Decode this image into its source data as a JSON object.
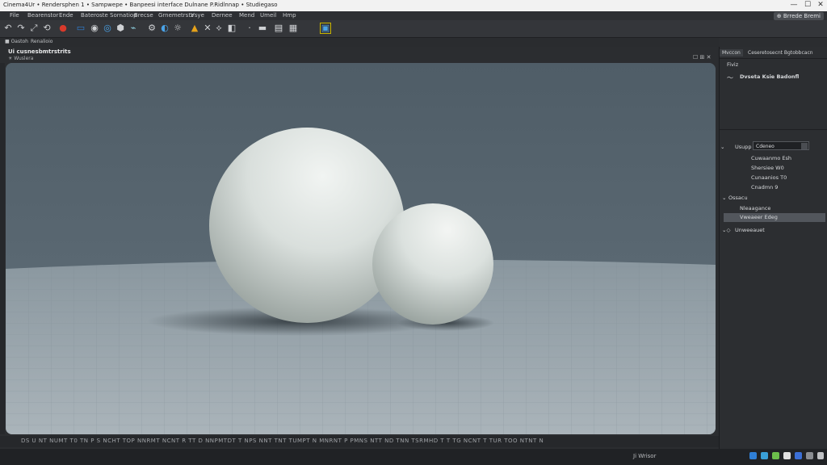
{
  "window": {
    "title": "Cinema4Ur • Rendersphen 1 • Sampwepe • Banpeesi interface Dulnane P.Ridlnnap • Studiegaso",
    "controls": [
      "—",
      "☐",
      "✕"
    ]
  },
  "menubar": {
    "items": [
      "File",
      "Bearenstor",
      "Ende",
      "Bateroste",
      "Sornatiop",
      "Brecse",
      "Grnemetrstz",
      "Vsye",
      "Dernee",
      "Mend",
      "Umeil",
      "Hmp"
    ],
    "right_label": "⊕ Brrede Bremi"
  },
  "toolbar": {
    "icons": [
      "undo-icon",
      "redo-icon",
      "move-icon",
      "rotate-icon",
      "record-icon",
      "camera-icon",
      "sphere-icon",
      "globe-icon",
      "cube-icon",
      "deformer-icon",
      "settings-icon",
      "world-icon",
      "sun-icon",
      "warning-icon",
      "axis-icon",
      "lasso-icon",
      "render-icon",
      "dot-icon",
      "bar-icon",
      "layers-icon",
      "display-icon",
      "active-tool-icon"
    ],
    "glyphs": [
      "↶",
      "↷",
      "⤢",
      "⟲",
      "●",
      "▭",
      "◉",
      "◎",
      "⬢",
      "⌁",
      "⚙",
      "◐",
      "☼",
      "▲",
      "✕",
      "⟡",
      "◧",
      "·",
      "▬",
      "▤",
      "▦",
      "▣"
    ]
  },
  "tabs": [
    "■ Oastoh",
    "Renalioio"
  ],
  "viewport": {
    "label": "Ui cusnesbmtrstrits",
    "sublabel": "☀ Wuslera",
    "corner_icons": "☐ ⊞ ✕"
  },
  "timeline": {
    "ticks": "DS  U  NT NUMT  T0  TN  P S  NCHT  TOP  NNRMT  NCNT  R  TT  D  NNPMTDT  T  NPS  NNT  TNT  TUMPT  N  MNRNT  P PMNS  NTT  ND  TNN  TSRMHD  T  T  TG  NCNT  T  TUR  TOO  NTNT  N"
  },
  "panel": {
    "tabs": [
      "Mvccon",
      "Ceseretosecnt Bgtobbcacn"
    ],
    "section_title": "Fiviz",
    "object_row": "Dvseta Ksie Badonfl",
    "layer_label": "Usupp",
    "layer_value": "Cdeneo",
    "materials": [
      "Cuwaanmo Esh",
      "Shersiee W0",
      "Cunaanios T0",
      "Cnadmn 9"
    ],
    "group_title": "Ossacu",
    "group_items": [
      "Nleaagance",
      "Vweaeer Edeg"
    ],
    "footer_row": "Unweeauet"
  },
  "statusbar": {
    "text": "Ji Wrisor"
  },
  "colors": {
    "accent_blue": "#2f7fd6",
    "selection_yellow": "#c8b400",
    "viewport_bg": "#4e5c66"
  }
}
